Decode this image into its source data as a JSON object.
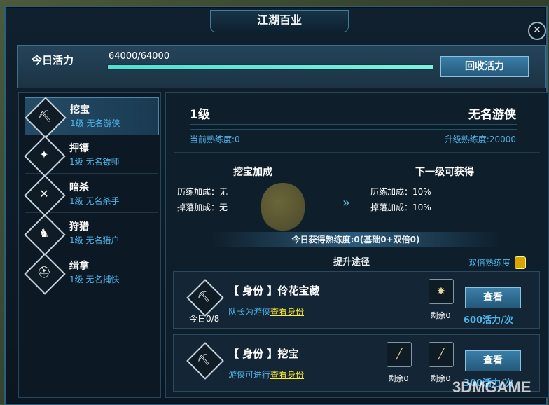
{
  "window": {
    "title": "江湖百业",
    "close_glyph": "✕"
  },
  "vitality": {
    "label": "今日活力",
    "value": "64000/64000",
    "progress": 1.0,
    "recover_button": "回收活力"
  },
  "professions": [
    {
      "name": "挖宝",
      "subtitle": "1级 无名游侠",
      "icon": "shovel-icon",
      "glyph": "⛏",
      "active": true
    },
    {
      "name": "押镖",
      "subtitle": "1级 无名镖师",
      "icon": "escort-icon",
      "glyph": "✦",
      "active": false
    },
    {
      "name": "暗杀",
      "subtitle": "1级 无名杀手",
      "icon": "crossed-swords-icon",
      "glyph": "✕",
      "active": false
    },
    {
      "name": "狩猎",
      "subtitle": "1级 无名猎户",
      "icon": "deer-icon",
      "glyph": "♞",
      "active": false
    },
    {
      "name": "缉拿",
      "subtitle": "1级 无名捕快",
      "icon": "helmet-icon",
      "glyph": "⛑",
      "active": false
    }
  ],
  "detail": {
    "level": "1级",
    "rank": "无名游侠",
    "current_exp_label": "当前熟练度:0",
    "next_exp_label": "升级熟练度:20000",
    "progress": 0.0,
    "bonus_title": "挖宝加成",
    "next_title": "下一级可获得",
    "bonus_lines": [
      "历练加成：无",
      "掉落加成：无"
    ],
    "next_lines": [
      "历练加成：10%",
      "掉落加成：10%"
    ],
    "today_exp": "今日获得熟练度:0(基础0+双倍0)",
    "path_title": "提升途径",
    "double_label": "双倍熟练度"
  },
  "cards": [
    {
      "title": "【 身份 】伶花宝藏",
      "today": "今日0/8",
      "desc_prefix": "队长为游侠",
      "desc_link": "查看身份",
      "items": [
        {
          "icon": "bronze-medal-icon",
          "glyph": "✸",
          "label": "剩余0"
        }
      ],
      "button": "查看",
      "cost": "600活力/次"
    },
    {
      "title": "【 身份 】挖宝",
      "today": "",
      "desc_prefix": "游侠可进行",
      "desc_link": "查看身份",
      "items": [
        {
          "icon": "chisel-tool-icon",
          "glyph": "╱",
          "label": "剩余0"
        },
        {
          "icon": "chisel-tool-icon",
          "glyph": "╱",
          "label": "剩余0"
        }
      ],
      "button": "查看",
      "cost": "300活力/次"
    }
  ],
  "watermark": "3DMGAME",
  "colors": {
    "accent_blue": "#4fb4ea",
    "teal_bar": "#5fe3d0",
    "panel_bg": "#0f1e2b",
    "border": "#3f6e88",
    "link_yellow": "#ffeb3b"
  }
}
